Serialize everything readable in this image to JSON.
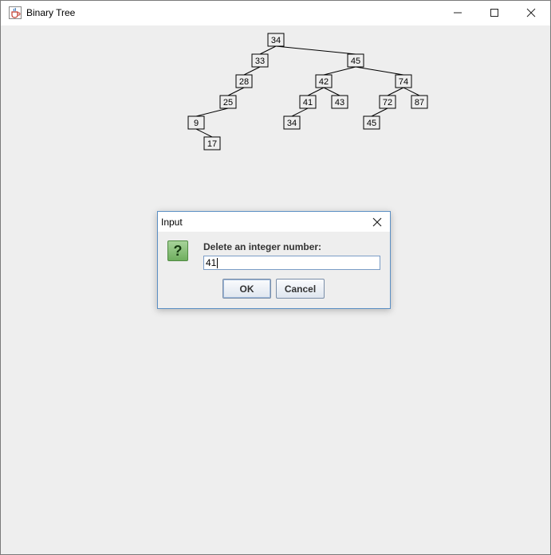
{
  "window": {
    "title": "Binary Tree",
    "icon": "java-cup-icon",
    "controls": [
      "minimize-icon",
      "maximize-icon",
      "close-icon"
    ]
  },
  "tree": {
    "nodes": [
      {
        "id": "n34a",
        "value": "34"
      },
      {
        "id": "n33",
        "value": "33"
      },
      {
        "id": "n45a",
        "value": "45"
      },
      {
        "id": "n28",
        "value": "28"
      },
      {
        "id": "n42",
        "value": "42"
      },
      {
        "id": "n74",
        "value": "74"
      },
      {
        "id": "n25",
        "value": "25"
      },
      {
        "id": "n41",
        "value": "41"
      },
      {
        "id": "n43",
        "value": "43"
      },
      {
        "id": "n72",
        "value": "72"
      },
      {
        "id": "n87",
        "value": "87"
      },
      {
        "id": "n9",
        "value": "9"
      },
      {
        "id": "n34b",
        "value": "34"
      },
      {
        "id": "n45b",
        "value": "45"
      },
      {
        "id": "n17",
        "value": "17"
      }
    ],
    "edges": [
      [
        "n34a",
        "n33"
      ],
      [
        "n34a",
        "n45a"
      ],
      [
        "n33",
        "n28"
      ],
      [
        "n28",
        "n25"
      ],
      [
        "n25",
        "n9"
      ],
      [
        "n9",
        "n17"
      ],
      [
        "n45a",
        "n42"
      ],
      [
        "n45a",
        "n74"
      ],
      [
        "n42",
        "n41"
      ],
      [
        "n42",
        "n43"
      ],
      [
        "n41",
        "n34b"
      ],
      [
        "n74",
        "n72"
      ],
      [
        "n74",
        "n87"
      ],
      [
        "n72",
        "n45b"
      ]
    ]
  },
  "dialog": {
    "title": "Input",
    "icon": "question-icon",
    "prompt": "Delete an integer number:",
    "input_value": "41",
    "ok_label": "OK",
    "cancel_label": "Cancel"
  }
}
